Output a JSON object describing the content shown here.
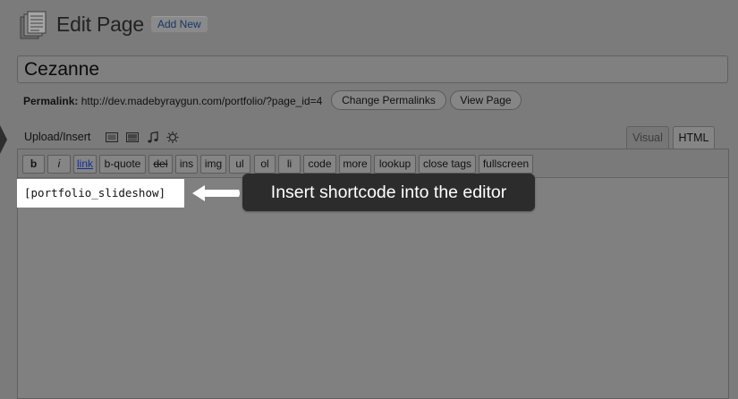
{
  "header": {
    "icon": "pages-icon",
    "title": "Edit Page",
    "add_new": "Add New"
  },
  "post": {
    "title": "Cezanne"
  },
  "permalink": {
    "label": "Permalink:",
    "url": "http://dev.madebyraygun.com/portfolio/?page_id=4",
    "change_button": "Change Permalinks",
    "view_button": "View Page"
  },
  "media": {
    "label": "Upload/Insert",
    "icons": [
      "image-icon",
      "video-icon",
      "audio-icon",
      "media-icon"
    ]
  },
  "tabs": {
    "visual": "Visual",
    "html": "HTML",
    "active": "HTML"
  },
  "quicktags": {
    "b": "b",
    "i": "i",
    "link": "link",
    "bquote": "b-quote",
    "del": "del",
    "ins": "ins",
    "img": "img",
    "ul": "ul",
    "ol": "ol",
    "li": "li",
    "code": "code",
    "more": "more",
    "lookup": "lookup",
    "close": "close tags",
    "fullscreen": "fullscreen"
  },
  "editor": {
    "content": "[portfolio_slideshow]"
  },
  "callout": {
    "text": "Insert shortcode into the editor"
  }
}
